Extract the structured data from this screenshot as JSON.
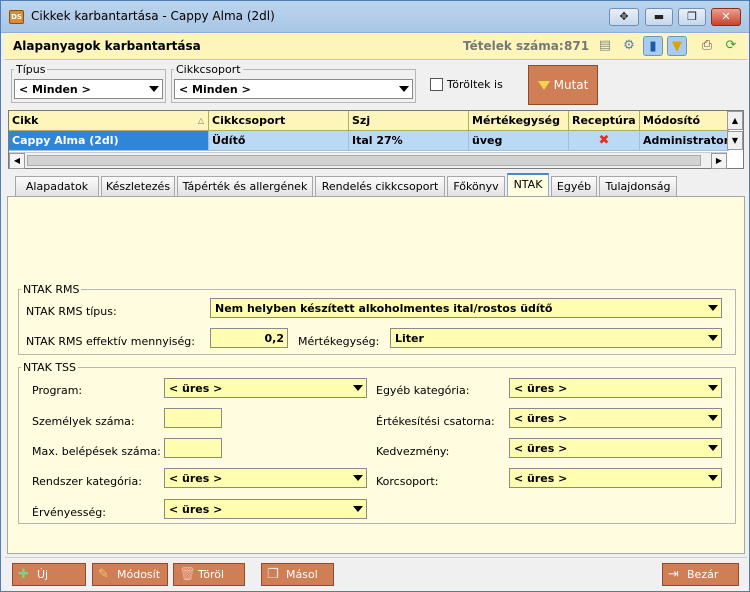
{
  "window": {
    "title": "Cikkek karbantartása - Cappy Alma (2dl)",
    "icon_text": "DS",
    "controls": [
      "move-icon",
      "minimize-icon",
      "maximize-icon",
      "close-icon"
    ]
  },
  "header": {
    "title": "Alapanyagok karbantartása",
    "count_label": "Tételek száma:",
    "count_value": "871",
    "toolbar_icons": [
      "document-icon",
      "gear-icon",
      "database-icon",
      "filter-icon",
      "print-icon",
      "refresh-icon"
    ]
  },
  "filters": {
    "tipus_label": "Típus",
    "tipus_value": "< Minden >",
    "cikkcsoport_label": "Cikkcsoport",
    "cikkcsoport_value": "< Minden >",
    "toroltek_label": "Töröltek is",
    "toroltek_checked": false,
    "mutat_label": "Mutat"
  },
  "grid": {
    "columns": [
      "Cikk",
      "Cikkcsoport",
      "Szj",
      "Mértékegység",
      "Receptúra",
      "Módosító"
    ],
    "rows": [
      {
        "cikk": "Cappy Alma (2dl)",
        "cikkcsoport": "Üdítő",
        "szj": "Ital 27%",
        "mertekegyseg": "üveg",
        "receptura": "✖",
        "modosito": "Administrator"
      }
    ]
  },
  "tabs": [
    {
      "label": "Alapadatok",
      "active": false
    },
    {
      "label": "Készletezés",
      "active": false
    },
    {
      "label": "Tápérték és allergének",
      "active": false
    },
    {
      "label": "Rendelés cikkcsoport",
      "active": false
    },
    {
      "label": "Főkönyv",
      "active": false
    },
    {
      "label": "NTAK",
      "active": true
    },
    {
      "label": "Egyéb",
      "active": false
    },
    {
      "label": "Tulajdonság",
      "active": false
    }
  ],
  "ntak_rms": {
    "group_label": "NTAK RMS",
    "tipus_label": "NTAK RMS típus:",
    "tipus_value": "Nem helyben készített alkoholmentes ital/rostos üdítő",
    "mennyiseg_label": "NTAK RMS effektív mennyiség:",
    "mennyiseg_value": "0,2",
    "mertekegyseg_label": "Mértékegység:",
    "mertekegyseg_value": "Liter"
  },
  "ntak_tss": {
    "group_label": "NTAK TSS",
    "program_label": "Program:",
    "program_value": "< üres >",
    "szemelyek_label": "Személyek száma:",
    "szemelyek_value": "",
    "belepesek_label": "Max. belépések száma:",
    "belepesek_value": "",
    "rendszer_label": "Rendszer kategória:",
    "rendszer_value": "< üres >",
    "ervenyesseg_label": "Érvényesség:",
    "ervenyesseg_value": "< üres >",
    "egyeb_label": "Egyéb kategória:",
    "egyeb_value": "< üres >",
    "csatorna_label": "Értékesítési csatorna:",
    "csatorna_value": "< üres >",
    "kedvezmeny_label": "Kedvezmény:",
    "kedvezmeny_value": "< üres >",
    "korcsoport_label": "Korcsoport:",
    "korcsoport_value": "< üres >"
  },
  "buttons": {
    "uj": "Új",
    "modosit": "Módosít",
    "torol": "Töröl",
    "masol": "Másol",
    "bezar": "Bezár"
  },
  "colors": {
    "accent_button": "#cf7e56",
    "header_yellow": "#fdf5b9",
    "selected_row": "#b9d9f5",
    "selected_cell": "#2f86d8",
    "panel_bg": "#fffcdf"
  }
}
